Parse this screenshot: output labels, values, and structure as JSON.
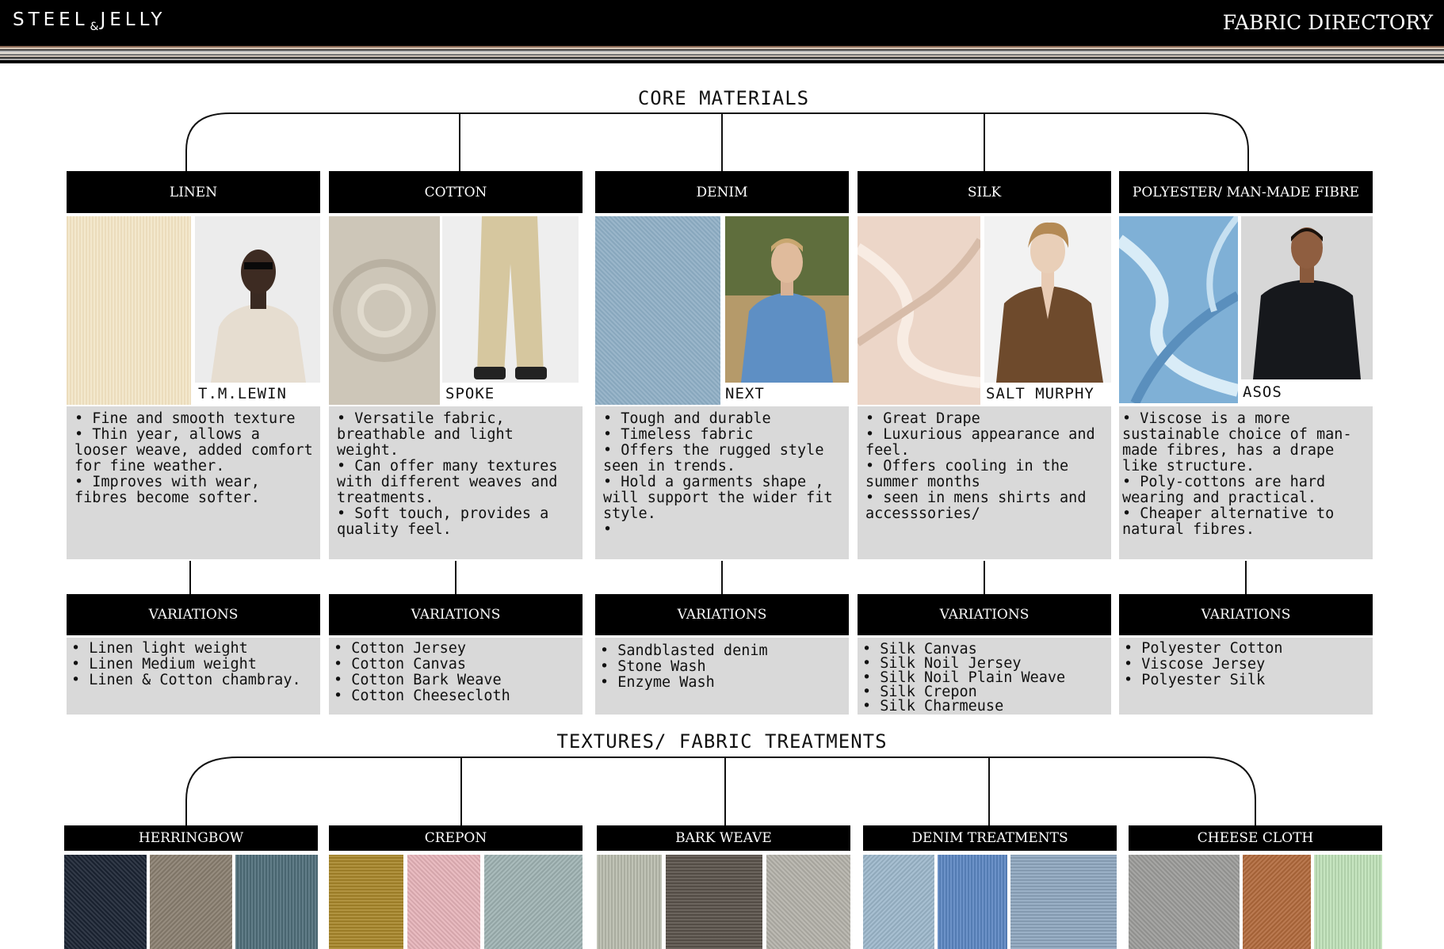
{
  "header": {
    "logo_left": "STEEL",
    "logo_amp": "&",
    "logo_right": "JELLY",
    "title": "FABRIC DIRECTORY"
  },
  "core": {
    "title": "CORE MATERIALS",
    "variations_label": "VARIATIONS",
    "columns": [
      {
        "name": "LINEN",
        "credit": "T.M.LEWIN",
        "notes": [
          "Fine and smooth texture",
          "Thin year, allows a looser weave, added comfort for fine weather.",
          "Improves with wear, fibres become softer."
        ],
        "variations": [
          "Linen light weight",
          "Linen Medium weight",
          "Linen & Cotton chambray."
        ]
      },
      {
        "name": "COTTON",
        "credit": "SPOKE",
        "notes": [
          "Versatile fabric, breathable and light weight.",
          "Can offer many textures with different weaves and treatments.",
          "Soft touch, provides a quality feel."
        ],
        "variations": [
          "Cotton Jersey",
          "Cotton Canvas",
          "Cotton Bark Weave",
          "Cotton Cheesecloth"
        ]
      },
      {
        "name": "DENIM",
        "credit": "NEXT",
        "notes": [
          "Tough and durable",
          "Timeless fabric",
          "Offers the rugged style seen in trends.",
          "Hold a garments shape , will support the wider fit style.",
          ""
        ],
        "variations": [
          "Sandblasted denim",
          "Stone Wash",
          "Enzyme Wash"
        ]
      },
      {
        "name": "SILK",
        "credit": "SALT MURPHY",
        "notes": [
          "Great Drape",
          "Luxurious appearance and feel.",
          "Offers cooling in the summer months",
          "seen in mens shirts and accesssories/"
        ],
        "variations": [
          "Silk Canvas",
          "Silk Noil Jersey",
          "Silk Noil Plain Weave",
          "Silk Crepon",
          "Silk Charmeuse"
        ]
      },
      {
        "name": "POLYESTER/ MAN-MADE FIBRE",
        "credit": "ASOS",
        "notes": [
          "Viscose is a more sustainable choice of man-made fibres, has a drape like structure.",
          "Poly-cottons are hard wearing and practical.",
          "Cheaper alternative to natural fibres."
        ],
        "variations": [
          "Polyester Cotton",
          "Viscose Jersey",
          "Polyester Silk"
        ]
      }
    ]
  },
  "textures": {
    "title": "TEXTURES/ FABRIC TREATMENTS",
    "items": [
      {
        "name": "HERRINGBOW",
        "swatches": [
          "#1b2433",
          "#8a7f70",
          "#4f6e7a"
        ]
      },
      {
        "name": "CREPON",
        "swatches": [
          "#a8872a",
          "#e7b4ba",
          "#9fb3b3"
        ]
      },
      {
        "name": "BARK WEAVE",
        "swatches": [
          "#b9bcae",
          "#5a534b",
          "#b4b2aa"
        ]
      },
      {
        "name": "DENIM TREATMENTS",
        "swatches": [
          "#9db8cc",
          "#5b86c2",
          "#8fa7bf"
        ]
      },
      {
        "name": "CHEESE CLOTH",
        "swatches": [
          "#9c9c9a",
          "#b26a3c",
          "#bfe2b9"
        ]
      }
    ]
  }
}
